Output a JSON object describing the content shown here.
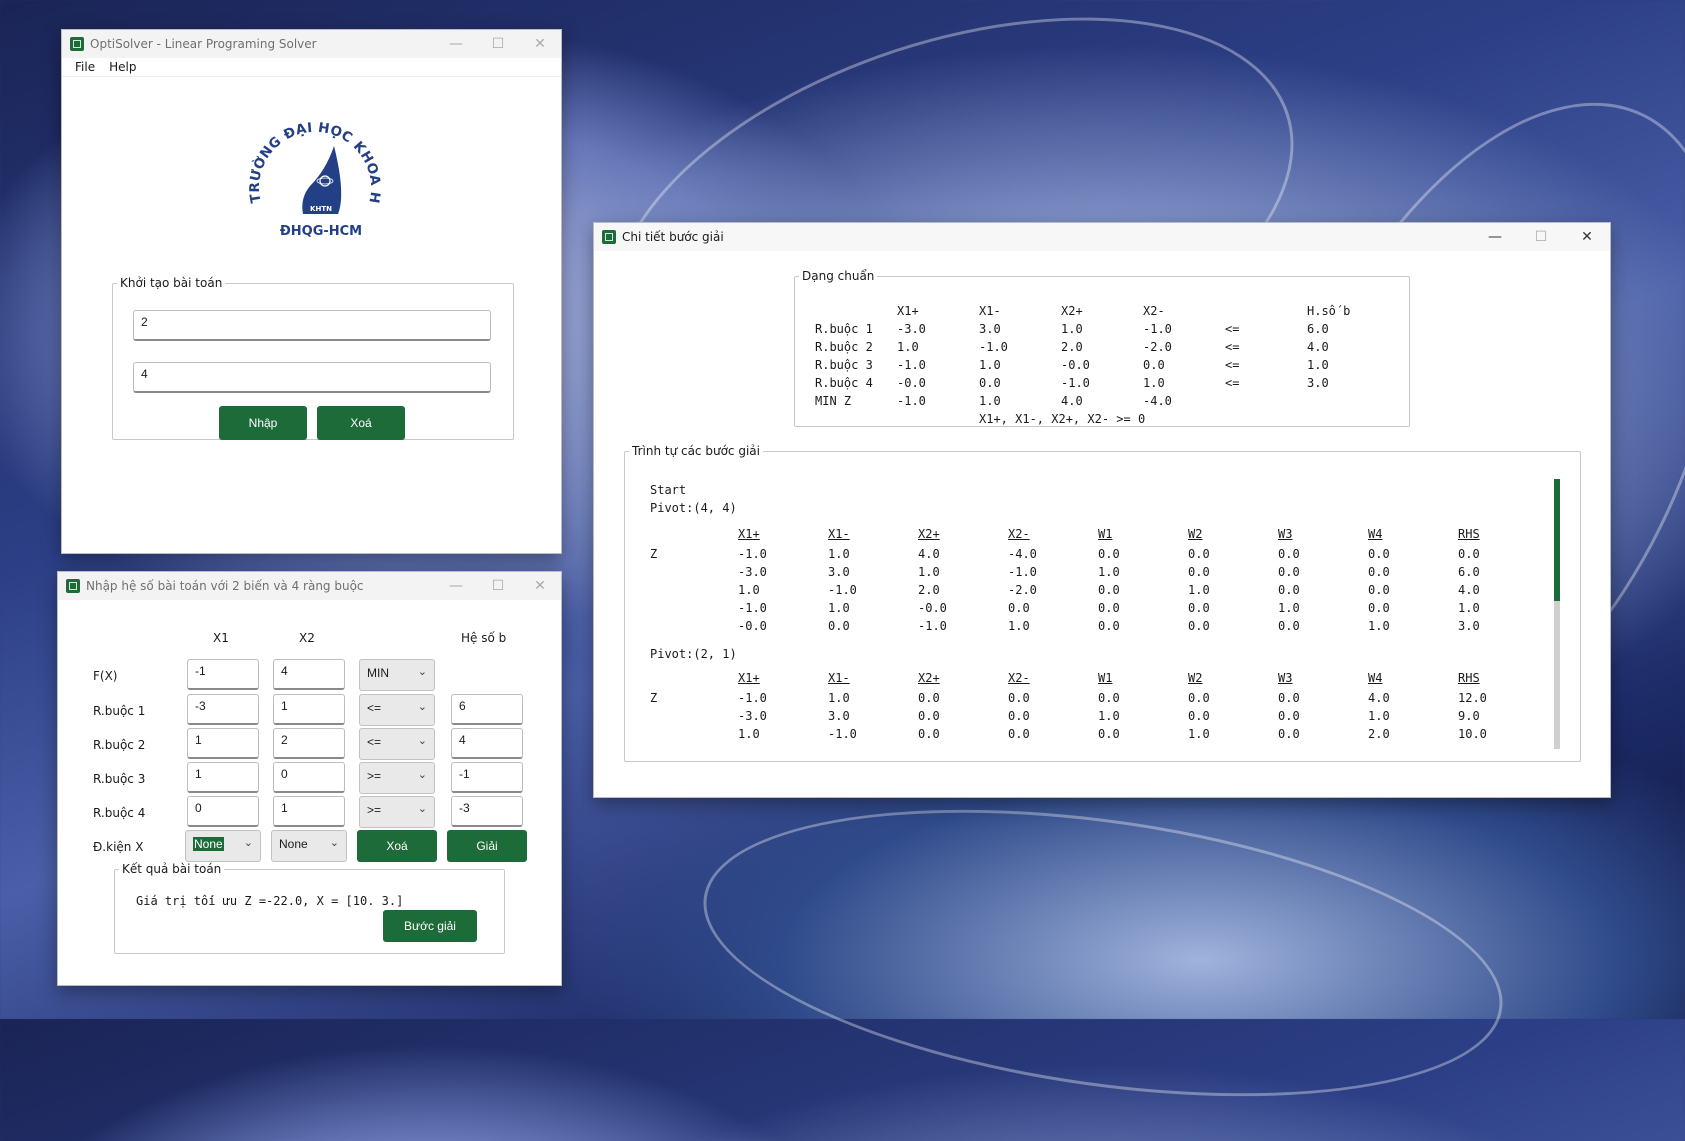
{
  "win_main": {
    "title": "OptiSolver - Linear Programing Solver",
    "menu": [
      "File",
      "Help"
    ],
    "logo": {
      "arc_text": "TRƯỜNG ĐẠI HỌC KHOA HỌC TỰ NHIÊN",
      "badge": "KHTN",
      "sub": "ĐHQG-HCM"
    },
    "init_group": "Khởi tạo bài toán",
    "num_vars": "2",
    "num_constraints": "4",
    "btn_enter": "Nhập",
    "btn_clear": "Xoá"
  },
  "win_input": {
    "title": "Nhập hệ số bài toán với 2 biến và 4 ràng buộc",
    "headers": {
      "x1": "X1",
      "x2": "X2",
      "b": "Hệ số b"
    },
    "fx_label": "F(X)",
    "fx": {
      "x1": "-1",
      "x2": "4",
      "objective": "MIN"
    },
    "constraints": [
      {
        "label": "R.buộc 1",
        "x1": "-3",
        "x2": "1",
        "op": "<=",
        "b": "6"
      },
      {
        "label": "R.buộc 2",
        "x1": "1",
        "x2": "2",
        "op": "<=",
        "b": "4"
      },
      {
        "label": "R.buộc 3",
        "x1": "1",
        "x2": "0",
        "op": ">=",
        "b": "-1"
      },
      {
        "label": "R.buộc 4",
        "x1": "0",
        "x2": "1",
        "op": ">=",
        "b": "-3"
      }
    ],
    "cond_label": "Đ.kiện X",
    "cond_x1": "None",
    "cond_x2": "None",
    "btn_clear": "Xoá",
    "btn_solve": "Giải",
    "result_group": "Kết quả bài toán",
    "result_text": "Giá trị tối ưu Z =-22.0, X = [10.  3.]",
    "btn_steps": "Bước giải"
  },
  "win_steps": {
    "title": "Chi tiết bước giải",
    "standard_group": "Dạng chuẩn",
    "standard": {
      "headers": [
        "X1+",
        "X1-",
        "X2+",
        "X2-",
        "",
        "H.số b"
      ],
      "rows": [
        {
          "label": "R.buộc 1",
          "vals": [
            "-3.0",
            "3.0",
            "1.0",
            "-1.0",
            "<=",
            "6.0"
          ]
        },
        {
          "label": "R.buộc 2",
          "vals": [
            "1.0",
            "-1.0",
            "2.0",
            "-2.0",
            "<=",
            "4.0"
          ]
        },
        {
          "label": "R.buộc 3",
          "vals": [
            "-1.0",
            "1.0",
            "-0.0",
            "0.0",
            "<=",
            "1.0"
          ]
        },
        {
          "label": "R.buộc 4",
          "vals": [
            "-0.0",
            "0.0",
            "-1.0",
            "1.0",
            "<=",
            "3.0"
          ]
        },
        {
          "label": "MIN Z",
          "vals": [
            "-1.0",
            "1.0",
            "4.0",
            "-4.0",
            "",
            ""
          ]
        }
      ],
      "nonneg": "X1+, X1-, X2+, X2- >= 0"
    },
    "steps_group": "Trình tự các bước giải",
    "start_label": "Start",
    "tableau_headers": [
      "X1+",
      "X1-",
      "X2+",
      "X2-",
      "W1",
      "W2",
      "W3",
      "W4",
      "RHS"
    ],
    "steps": [
      {
        "pivot": "Pivot:(4, 4)",
        "rows": [
          {
            "label": "Z",
            "vals": [
              "-1.0",
              "1.0",
              "4.0",
              "-4.0",
              "0.0",
              "0.0",
              "0.0",
              "0.0",
              "0.0"
            ]
          },
          {
            "label": "",
            "vals": [
              "-3.0",
              "3.0",
              "1.0",
              "-1.0",
              "1.0",
              "0.0",
              "0.0",
              "0.0",
              "6.0"
            ]
          },
          {
            "label": "",
            "vals": [
              "1.0",
              "-1.0",
              "2.0",
              "-2.0",
              "0.0",
              "1.0",
              "0.0",
              "0.0",
              "4.0"
            ]
          },
          {
            "label": "",
            "vals": [
              "-1.0",
              "1.0",
              "-0.0",
              "0.0",
              "0.0",
              "0.0",
              "1.0",
              "0.0",
              "1.0"
            ]
          },
          {
            "label": "",
            "vals": [
              "-0.0",
              "0.0",
              "-1.0",
              "1.0",
              "0.0",
              "0.0",
              "0.0",
              "1.0",
              "3.0"
            ]
          }
        ]
      },
      {
        "pivot": "Pivot:(2, 1)",
        "rows": [
          {
            "label": "Z",
            "vals": [
              "-1.0",
              "1.0",
              "0.0",
              "0.0",
              "0.0",
              "0.0",
              "0.0",
              "4.0",
              "12.0"
            ]
          },
          {
            "label": "",
            "vals": [
              "-3.0",
              "3.0",
              "0.0",
              "0.0",
              "1.0",
              "0.0",
              "0.0",
              "1.0",
              "9.0"
            ]
          },
          {
            "label": "",
            "vals": [
              "1.0",
              "-1.0",
              "0.0",
              "0.0",
              "0.0",
              "1.0",
              "0.0",
              "2.0",
              "10.0"
            ]
          }
        ]
      }
    ],
    "scroll_position": 0.45
  },
  "colors": {
    "accent": "#1e6b3a",
    "logo": "#233f86"
  }
}
